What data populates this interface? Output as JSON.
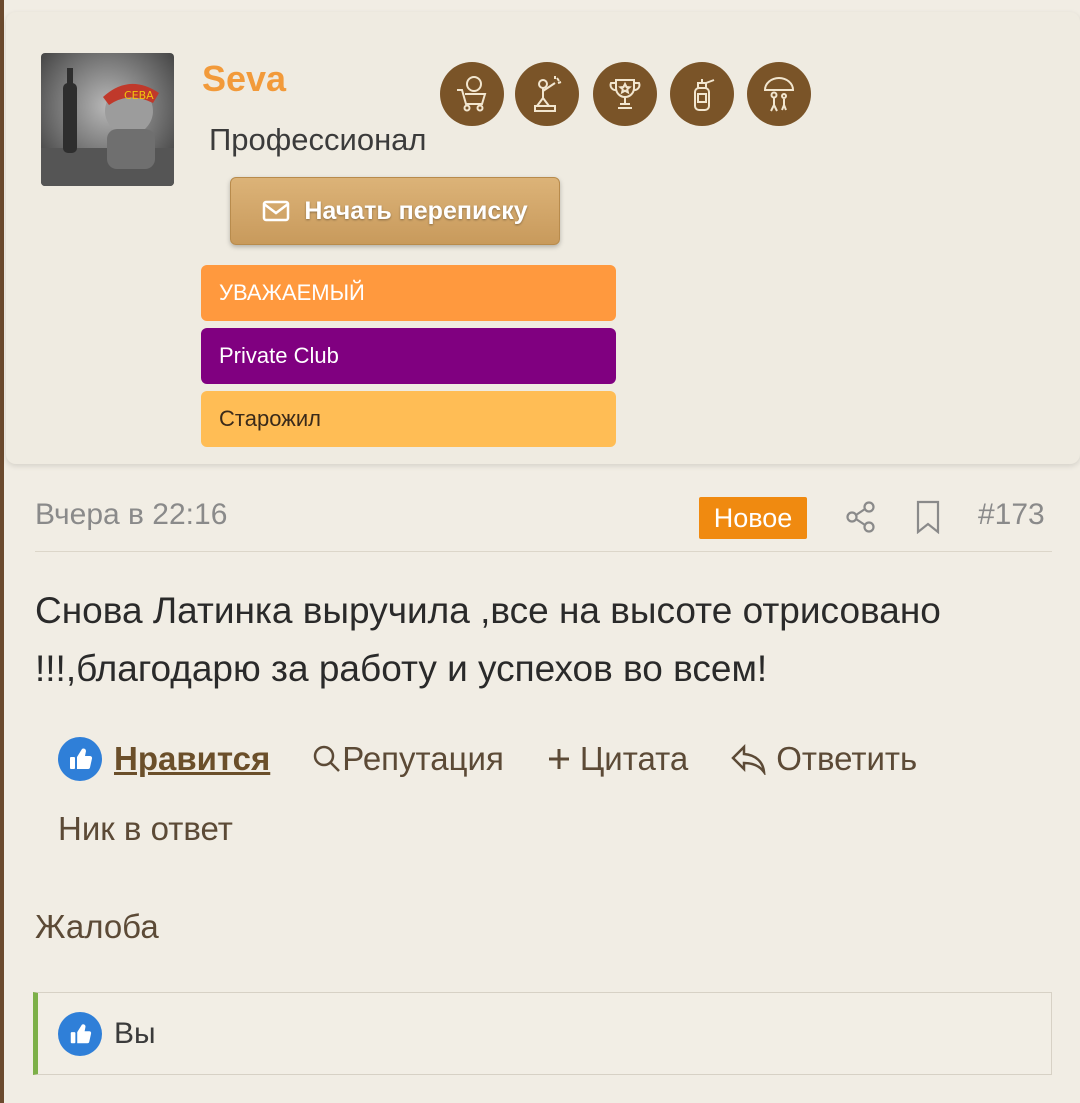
{
  "user": {
    "name": "Seva",
    "title": "Профессионал",
    "avatar_caption": "СЕВА",
    "message_button": "Начать переписку",
    "awards": [
      "cart-10-award-icon",
      "celebration-award-icon",
      "trophy-award-icon",
      "extinguisher-award-icon",
      "umbrella-family-award-icon"
    ],
    "banners": [
      {
        "label": "УВАЖАЕМЫЙ",
        "color": "#ff993e"
      },
      {
        "label": "Private Club",
        "color": "#800080"
      },
      {
        "label": "Старожил",
        "color": "#ffbd55"
      }
    ]
  },
  "post": {
    "date": "Вчера в 22:16",
    "new_badge": "Новое",
    "number": "#173",
    "body": "Снова Латинка выручила ,все на высоте отрисовано !!!,благодарю за работу и успехов во всем!"
  },
  "actions": {
    "like": "Нравится",
    "reputation": "Репутация",
    "quote": "Цитата",
    "reply": "Ответить",
    "nick_reply": "Ник в ответ",
    "complain": "Жалоба"
  },
  "likes": {
    "who": "Вы"
  },
  "colors": {
    "accent": "#f29a3a",
    "new": "#f08a10",
    "like_bar": "#7db048"
  }
}
